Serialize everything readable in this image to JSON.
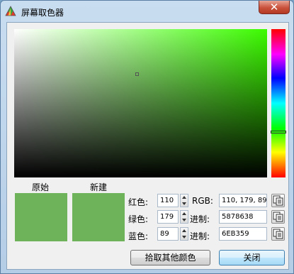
{
  "window": {
    "title": "屏幕取色器",
    "close_glyph": "✕"
  },
  "picker": {
    "hue_color": "#3cfc00",
    "original_label": "原始",
    "new_label": "新建",
    "original_color": "#6eb359",
    "new_color": "#6eb359"
  },
  "fields": {
    "red_label": "红色:",
    "red_value": "110",
    "green_label": "绿色:",
    "green_value": "179",
    "blue_label": "蓝色:",
    "blue_value": "89",
    "rgb_label": "RGB:",
    "rgb_value": "110, 179, 89",
    "dec_label": "进制:",
    "dec_value": "5878638",
    "hex_label": "进制:",
    "hex_value": "6EB359"
  },
  "buttons": {
    "pick_other": "拾取其他颜色",
    "close": "关闭"
  },
  "icons": {
    "app": "color-picker-icon",
    "copy": "copy-icon"
  }
}
